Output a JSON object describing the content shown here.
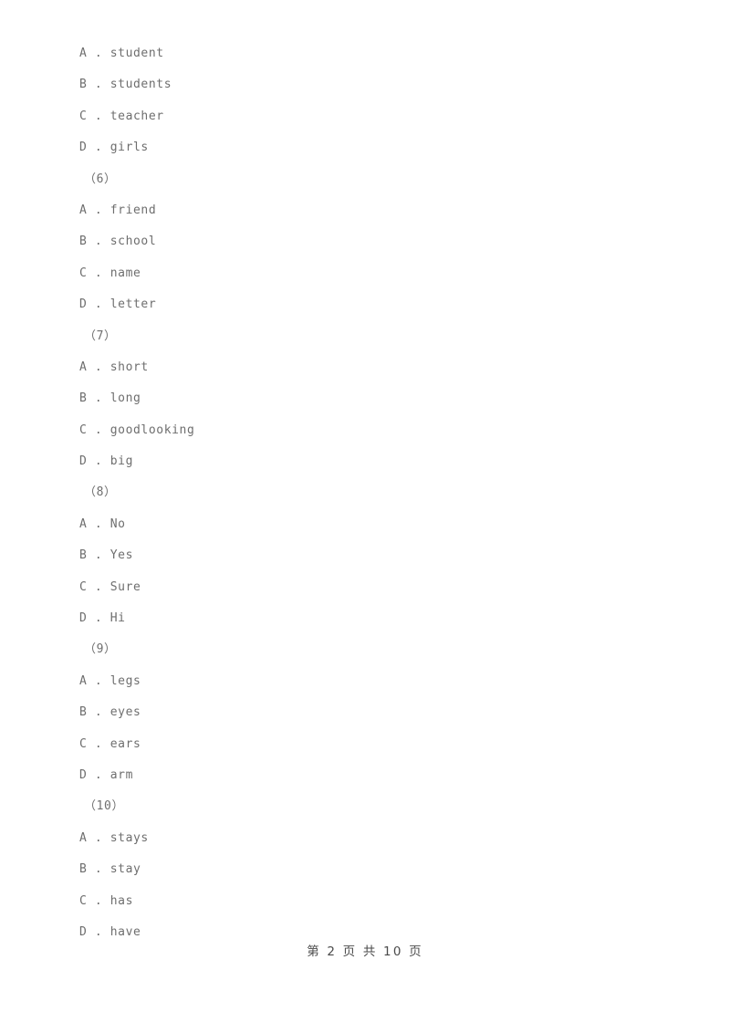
{
  "document": {
    "page_background": "#ffffff",
    "text_color": "#6e6e6e",
    "footer_color": "#4a4a4a"
  },
  "body_lines": [
    {
      "kind": "option",
      "letter": "A",
      "sep": " . ",
      "text": "student"
    },
    {
      "kind": "option",
      "letter": "B",
      "sep": " . ",
      "text": "students"
    },
    {
      "kind": "option",
      "letter": "C",
      "sep": " . ",
      "text": "teacher"
    },
    {
      "kind": "option",
      "letter": "D",
      "sep": " . ",
      "text": "girls"
    },
    {
      "kind": "qnum",
      "text": "（6）"
    },
    {
      "kind": "option",
      "letter": "A",
      "sep": " . ",
      "text": "friend"
    },
    {
      "kind": "option",
      "letter": "B",
      "sep": " . ",
      "text": "school"
    },
    {
      "kind": "option",
      "letter": "C",
      "sep": " . ",
      "text": "name"
    },
    {
      "kind": "option",
      "letter": "D",
      "sep": " . ",
      "text": "letter"
    },
    {
      "kind": "qnum",
      "text": "（7）"
    },
    {
      "kind": "option",
      "letter": "A",
      "sep": " . ",
      "text": "short"
    },
    {
      "kind": "option",
      "letter": "B",
      "sep": " . ",
      "text": "long"
    },
    {
      "kind": "option",
      "letter": "C",
      "sep": " . ",
      "text": "goodlooking"
    },
    {
      "kind": "option",
      "letter": "D",
      "sep": " . ",
      "text": "big"
    },
    {
      "kind": "qnum",
      "text": "（8）"
    },
    {
      "kind": "option",
      "letter": "A",
      "sep": " . ",
      "text": "No"
    },
    {
      "kind": "option",
      "letter": "B",
      "sep": " . ",
      "text": "Yes"
    },
    {
      "kind": "option",
      "letter": "C",
      "sep": " . ",
      "text": "Sure"
    },
    {
      "kind": "option",
      "letter": "D",
      "sep": " . ",
      "text": "Hi"
    },
    {
      "kind": "qnum",
      "text": "（9）"
    },
    {
      "kind": "option",
      "letter": "A",
      "sep": " . ",
      "text": "legs"
    },
    {
      "kind": "option",
      "letter": "B",
      "sep": " . ",
      "text": "eyes"
    },
    {
      "kind": "option",
      "letter": "C",
      "sep": " . ",
      "text": "ears"
    },
    {
      "kind": "option",
      "letter": "D",
      "sep": " . ",
      "text": "arm"
    },
    {
      "kind": "qnum",
      "text": "（10）"
    },
    {
      "kind": "option",
      "letter": "A",
      "sep": " . ",
      "text": "stays"
    },
    {
      "kind": "option",
      "letter": "B",
      "sep": " . ",
      "text": "stay"
    },
    {
      "kind": "option",
      "letter": "C",
      "sep": " . ",
      "text": "has"
    },
    {
      "kind": "option",
      "letter": "D",
      "sep": " . ",
      "text": "have"
    }
  ],
  "footer": {
    "text": "第 2 页 共 10 页",
    "current_page": "2",
    "total_pages": "10"
  }
}
